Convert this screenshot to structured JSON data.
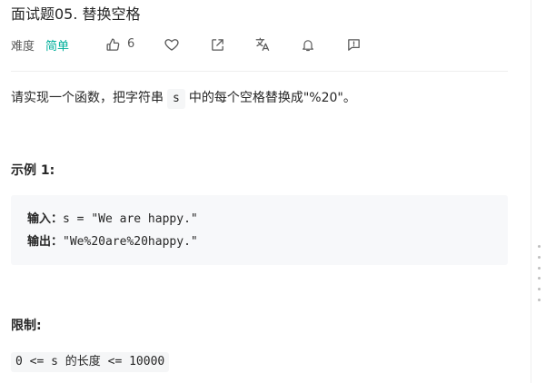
{
  "problem": {
    "title": "面试题05. 替换空格",
    "difficulty_label": "难度",
    "difficulty": "简单",
    "likes": "6"
  },
  "toolbar": {
    "icons": [
      "thumbs-up-icon",
      "heart-icon",
      "share-icon",
      "translate-icon",
      "bell-icon",
      "feedback-icon"
    ]
  },
  "description": {
    "text_before": "请实现一个函数，把字符串",
    "code": "s",
    "text_after": "中的每个空格替换成\"%20\"。"
  },
  "example": {
    "title": "示例 1:",
    "input_label": "输入：",
    "input_value": "s = \"We are happy.\"",
    "output_label": "输出：",
    "output_value": "\"We%20are%20happy.\""
  },
  "constraints": {
    "title": "限制:",
    "code": "0 <= s 的长度 <= 10000"
  },
  "colors": {
    "difficulty_easy": "#00af9b",
    "text": "#262626",
    "muted": "#595959",
    "code_bg": "#f7f8fa"
  }
}
